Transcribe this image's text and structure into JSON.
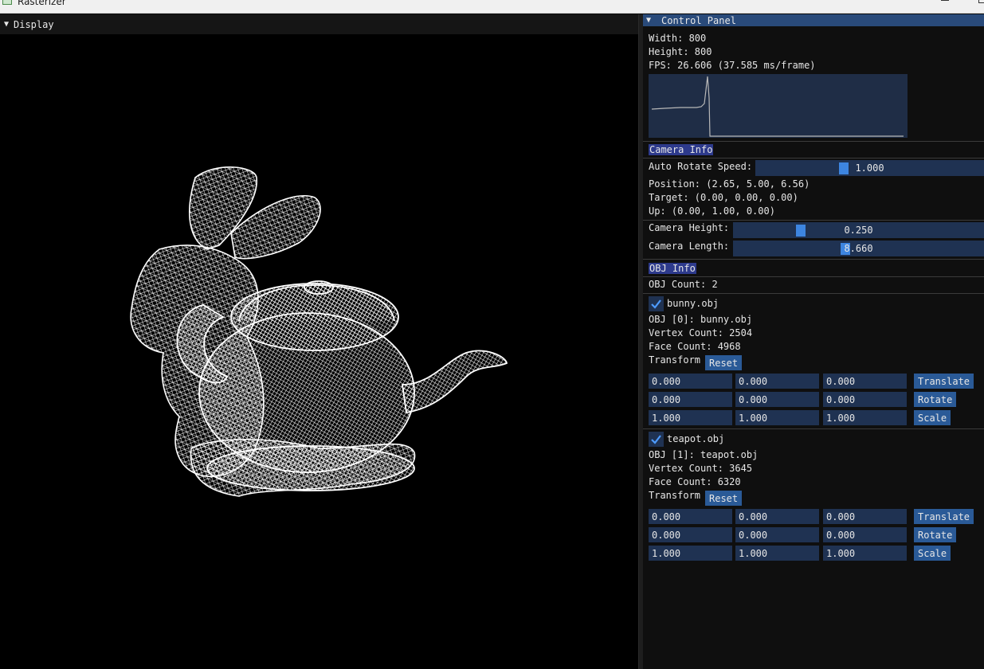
{
  "window": {
    "title": "Rasterizer"
  },
  "display": {
    "title": "Display"
  },
  "control_panel": {
    "title": "Control Panel",
    "width": "Width: 800",
    "height": "Height: 800",
    "fps": "FPS: 26.606 (37.585 ms/frame)",
    "camera": {
      "section": "Camera Info",
      "auto_rotate_label": "Auto Rotate Speed:",
      "auto_rotate_value": "1.000",
      "position": "Position: (2.65, 5.00, 6.56)",
      "target": "Target: (0.00, 0.00, 0.00)",
      "up": "Up: (0.00, 1.00, 0.00)",
      "height_label": "Camera Height:",
      "height_value": "0.250",
      "length_label": "Camera Length:",
      "length_value": "8.660"
    },
    "obj": {
      "section": "OBJ Info",
      "count": "OBJ Count: 2",
      "objects": [
        {
          "checkbox_label": "bunny.obj",
          "name_line": "OBJ [0]: bunny.obj",
          "vertex_count": "Vertex Count: 2504",
          "face_count": "Face Count: 4968",
          "transform_label": "Transform",
          "reset_label": "Reset",
          "translate": [
            "0.000",
            "0.000",
            "0.000"
          ],
          "rotate": [
            "0.000",
            "0.000",
            "0.000"
          ],
          "scale": [
            "1.000",
            "1.000",
            "1.000"
          ],
          "translate_label": "Translate",
          "rotate_label": "Rotate",
          "scale_label": "Scale"
        },
        {
          "checkbox_label": "teapot.obj",
          "name_line": "OBJ [1]: teapot.obj",
          "vertex_count": "Vertex Count: 3645",
          "face_count": "Face Count: 6320",
          "transform_label": "Transform",
          "reset_label": "Reset",
          "translate": [
            "0.000",
            "0.000",
            "0.000"
          ],
          "rotate": [
            "0.000",
            "0.000",
            "0.000"
          ],
          "scale": [
            "1.000",
            "1.000",
            "1.000"
          ],
          "translate_label": "Translate",
          "rotate_label": "Rotate",
          "scale_label": "Scale"
        }
      ]
    }
  }
}
